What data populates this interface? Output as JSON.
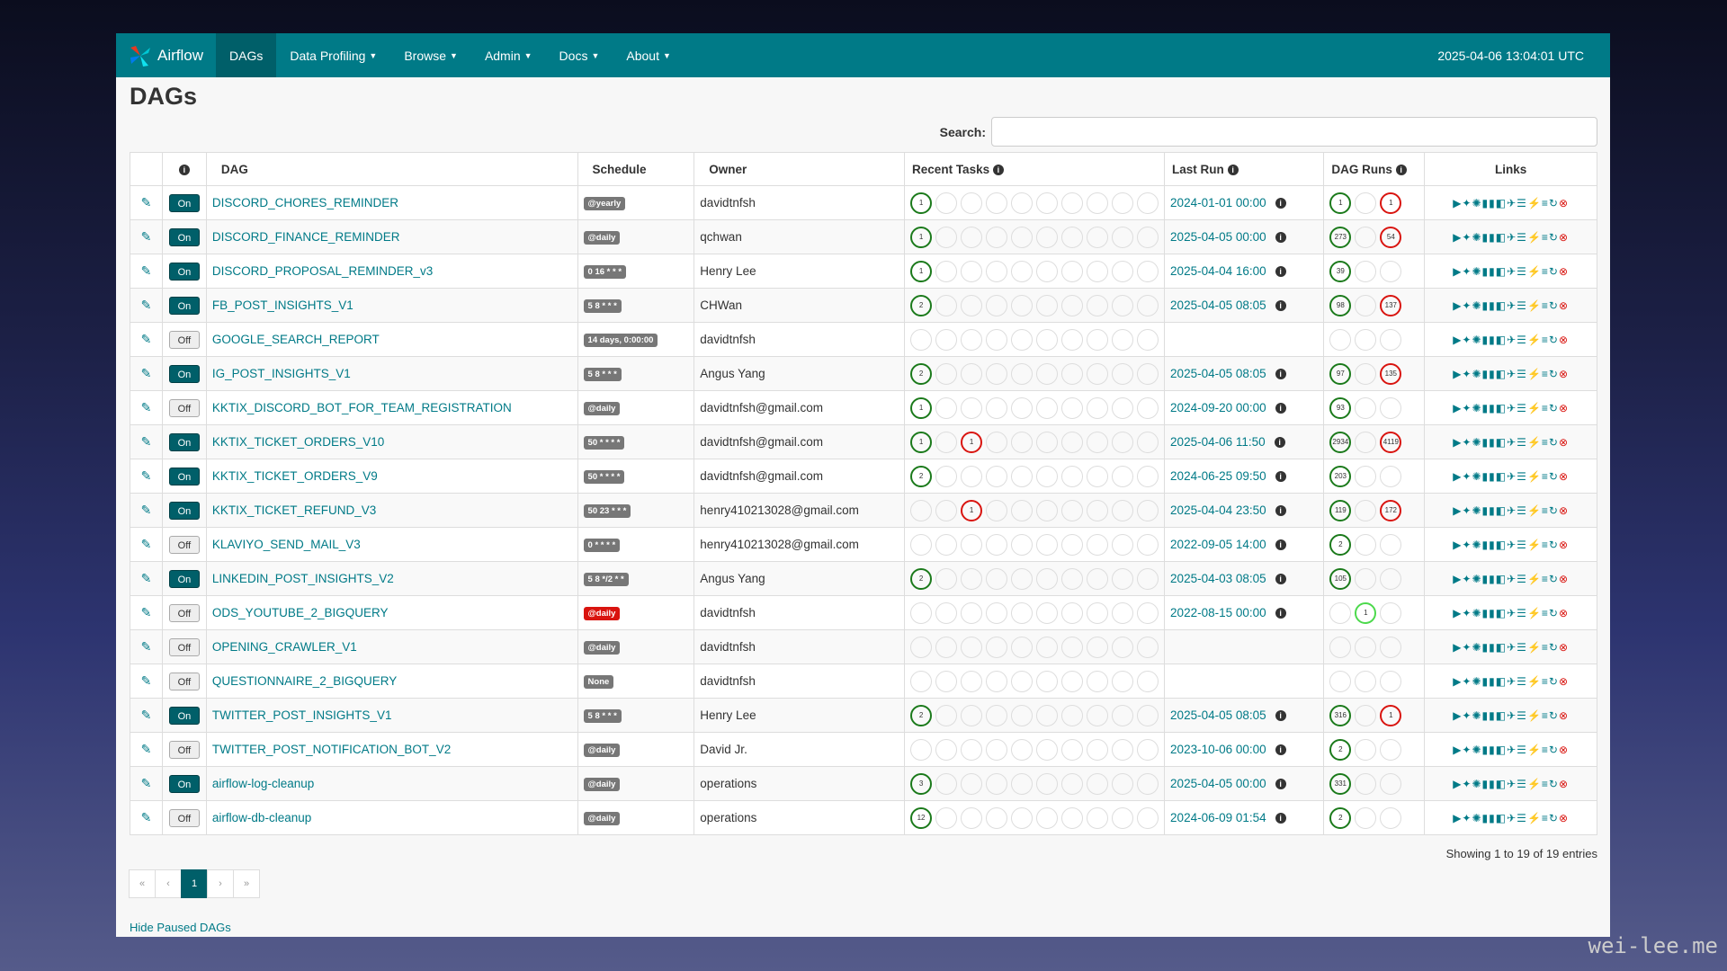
{
  "navbar": {
    "brand": "Airflow",
    "items": [
      {
        "label": "DAGs",
        "caret": false
      },
      {
        "label": "Data Profiling",
        "caret": true
      },
      {
        "label": "Browse",
        "caret": true
      },
      {
        "label": "Admin",
        "caret": true
      },
      {
        "label": "Docs",
        "caret": true
      },
      {
        "label": "About",
        "caret": true
      }
    ],
    "clock": "2025-04-06 13:04:01 UTC"
  },
  "page_title": "DAGs",
  "search": {
    "label": "Search:"
  },
  "table": {
    "headers": [
      "DAG",
      "Schedule",
      "Owner",
      "Recent Tasks",
      "Last Run",
      "DAG Runs",
      "Links"
    ],
    "rows": [
      {
        "toggle": "On",
        "dag": "DISCORD_CHORES_REMINDER",
        "schedule": "@yearly",
        "owner": "davidtnfsh",
        "tasks": [
          {
            "i": 0,
            "v": "1",
            "s": "g"
          }
        ],
        "last_run": "2024-01-01 00:00",
        "runs": [
          {
            "i": 0,
            "v": "1",
            "s": "g"
          },
          {
            "i": 2,
            "v": "1",
            "s": "r"
          }
        ]
      },
      {
        "toggle": "On",
        "dag": "DISCORD_FINANCE_REMINDER",
        "schedule": "@daily",
        "owner": "qchwan",
        "tasks": [
          {
            "i": 0,
            "v": "1",
            "s": "g"
          }
        ],
        "last_run": "2025-04-05 00:00",
        "runs": [
          {
            "i": 0,
            "v": "273",
            "s": "g"
          },
          {
            "i": 2,
            "v": "54",
            "s": "r"
          }
        ]
      },
      {
        "toggle": "On",
        "dag": "DISCORD_PROPOSAL_REMINDER_v3",
        "schedule": "0 16 * * *",
        "owner": "Henry Lee",
        "tasks": [
          {
            "i": 0,
            "v": "1",
            "s": "g"
          }
        ],
        "last_run": "2025-04-04 16:00",
        "runs": [
          {
            "i": 0,
            "v": "39",
            "s": "g"
          }
        ]
      },
      {
        "toggle": "On",
        "dag": "FB_POST_INSIGHTS_V1",
        "schedule": "5 8 * * *",
        "owner": "CHWan",
        "tasks": [
          {
            "i": 0,
            "v": "2",
            "s": "g"
          }
        ],
        "last_run": "2025-04-05 08:05",
        "runs": [
          {
            "i": 0,
            "v": "98",
            "s": "g"
          },
          {
            "i": 2,
            "v": "137",
            "s": "r"
          }
        ]
      },
      {
        "toggle": "Off",
        "dag": "GOOGLE_SEARCH_REPORT",
        "schedule": "14 days, 0:00:00",
        "owner": "davidtnfsh",
        "tasks": [],
        "last_run": "",
        "runs": []
      },
      {
        "toggle": "On",
        "dag": "IG_POST_INSIGHTS_V1",
        "schedule": "5 8 * * *",
        "owner": "Angus Yang",
        "tasks": [
          {
            "i": 0,
            "v": "2",
            "s": "g"
          }
        ],
        "last_run": "2025-04-05 08:05",
        "runs": [
          {
            "i": 0,
            "v": "97",
            "s": "g"
          },
          {
            "i": 2,
            "v": "135",
            "s": "r"
          }
        ]
      },
      {
        "toggle": "Off",
        "dag": "KKTIX_DISCORD_BOT_FOR_TEAM_REGISTRATION",
        "schedule": "@daily",
        "owner": "davidtnfsh@gmail.com",
        "tasks": [
          {
            "i": 0,
            "v": "1",
            "s": "g"
          }
        ],
        "last_run": "2024-09-20 00:00",
        "runs": [
          {
            "i": 0,
            "v": "93",
            "s": "g"
          }
        ]
      },
      {
        "toggle": "On",
        "dag": "KKTIX_TICKET_ORDERS_V10",
        "schedule": "50 * * * *",
        "owner": "davidtnfsh@gmail.com",
        "tasks": [
          {
            "i": 0,
            "v": "1",
            "s": "g"
          },
          {
            "i": 2,
            "v": "1",
            "s": "r"
          }
        ],
        "last_run": "2025-04-06 11:50",
        "runs": [
          {
            "i": 0,
            "v": "2934",
            "s": "g"
          },
          {
            "i": 2,
            "v": "4119",
            "s": "r"
          }
        ]
      },
      {
        "toggle": "On",
        "dag": "KKTIX_TICKET_ORDERS_V9",
        "schedule": "50 * * * *",
        "owner": "davidtnfsh@gmail.com",
        "tasks": [
          {
            "i": 0,
            "v": "2",
            "s": "g"
          }
        ],
        "last_run": "2024-06-25 09:50",
        "runs": [
          {
            "i": 0,
            "v": "203",
            "s": "g"
          }
        ]
      },
      {
        "toggle": "On",
        "dag": "KKTIX_TICKET_REFUND_V3",
        "schedule": "50 23 * * *",
        "owner": "henry410213028@gmail.com",
        "tasks": [
          {
            "i": 2,
            "v": "1",
            "s": "r"
          }
        ],
        "last_run": "2025-04-04 23:50",
        "runs": [
          {
            "i": 0,
            "v": "119",
            "s": "g"
          },
          {
            "i": 2,
            "v": "172",
            "s": "r"
          }
        ]
      },
      {
        "toggle": "Off",
        "dag": "KLAVIYO_SEND_MAIL_V3",
        "schedule": "0 * * * *",
        "owner": "henry410213028@gmail.com",
        "tasks": [],
        "last_run": "2022-09-05 14:00",
        "runs": [
          {
            "i": 0,
            "v": "2",
            "s": "g"
          }
        ]
      },
      {
        "toggle": "On",
        "dag": "LINKEDIN_POST_INSIGHTS_V2",
        "schedule": "5 8 */2 * *",
        "owner": "Angus Yang",
        "tasks": [
          {
            "i": 0,
            "v": "2",
            "s": "g"
          }
        ],
        "last_run": "2025-04-03 08:05",
        "runs": [
          {
            "i": 0,
            "v": "105",
            "s": "g"
          }
        ]
      },
      {
        "toggle": "Off",
        "dag": "ODS_YOUTUBE_2_BIGQUERY",
        "schedule": "@daily",
        "schedule_red": true,
        "owner": "davidtnfsh",
        "tasks": [],
        "last_run": "2022-08-15 00:00",
        "runs": [
          {
            "i": 1,
            "v": "1",
            "s": "lg"
          }
        ]
      },
      {
        "toggle": "Off",
        "dag": "OPENING_CRAWLER_V1",
        "schedule": "@daily",
        "owner": "davidtnfsh",
        "tasks": [],
        "last_run": "",
        "runs": []
      },
      {
        "toggle": "Off",
        "dag": "QUESTIONNAIRE_2_BIGQUERY",
        "schedule": "None",
        "owner": "davidtnfsh",
        "tasks": [],
        "last_run": "",
        "runs": []
      },
      {
        "toggle": "On",
        "dag": "TWITTER_POST_INSIGHTS_V1",
        "schedule": "5 8 * * *",
        "owner": "Henry Lee",
        "tasks": [
          {
            "i": 0,
            "v": "2",
            "s": "g"
          }
        ],
        "last_run": "2025-04-05 08:05",
        "runs": [
          {
            "i": 0,
            "v": "316",
            "s": "g"
          },
          {
            "i": 2,
            "v": "1",
            "s": "r"
          }
        ]
      },
      {
        "toggle": "Off",
        "dag": "TWITTER_POST_NOTIFICATION_BOT_V2",
        "schedule": "@daily",
        "owner": "David Jr.",
        "tasks": [],
        "last_run": "2023-10-06 00:00",
        "runs": [
          {
            "i": 0,
            "v": "2",
            "s": "g"
          }
        ]
      },
      {
        "toggle": "On",
        "dag": "airflow-log-cleanup",
        "schedule": "@daily",
        "owner": "operations",
        "tasks": [
          {
            "i": 0,
            "v": "3",
            "s": "g"
          }
        ],
        "last_run": "2025-04-05 00:00",
        "runs": [
          {
            "i": 0,
            "v": "331",
            "s": "g"
          }
        ]
      },
      {
        "toggle": "Off",
        "dag": "airflow-db-cleanup",
        "schedule": "@daily",
        "owner": "operations",
        "tasks": [
          {
            "i": 0,
            "v": "12",
            "s": "g"
          }
        ],
        "last_run": "2024-06-09 01:54",
        "runs": [
          {
            "i": 0,
            "v": "2",
            "s": "g"
          }
        ]
      }
    ]
  },
  "showing": "Showing 1 to 19 of 19 entries",
  "pager": {
    "first": "«",
    "prev": "‹",
    "current": "1",
    "next": "›",
    "last": "»"
  },
  "hide_paused": "Hide Paused DAGs",
  "watermark": "wei-lee.me",
  "colors": {
    "navbar": "#007a87",
    "success": "#1b7a1b",
    "failed": "#d9140f"
  }
}
